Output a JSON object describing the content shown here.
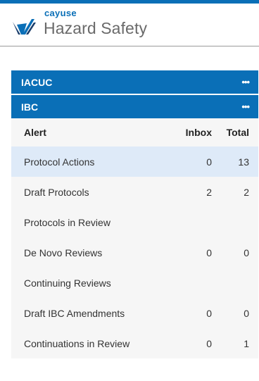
{
  "brand": {
    "company": "cayuse",
    "product": "Hazard Safety",
    "accent_color": "#0a6fb7"
  },
  "panels": [
    {
      "title": "IACUC",
      "menu_icon": "more-horizontal-icon"
    },
    {
      "title": "IBC",
      "menu_icon": "more-horizontal-icon"
    }
  ],
  "ibc_table": {
    "columns": {
      "alert": "Alert",
      "inbox": "Inbox",
      "total": "Total"
    },
    "rows": [
      {
        "alert": "Protocol Actions",
        "inbox": "0",
        "total": "13"
      },
      {
        "alert": "Draft Protocols",
        "inbox": "2",
        "total": "2"
      },
      {
        "alert": "Protocols in Review",
        "inbox": "",
        "total": ""
      },
      {
        "alert": "De Novo Reviews",
        "inbox": "0",
        "total": "0"
      },
      {
        "alert": "Continuing Reviews",
        "inbox": "",
        "total": ""
      },
      {
        "alert": "Draft IBC Amendments",
        "inbox": "0",
        "total": "0"
      },
      {
        "alert": "Continuations in Review",
        "inbox": "0",
        "total": "1"
      }
    ],
    "selected_row": "Protocol Actions"
  }
}
